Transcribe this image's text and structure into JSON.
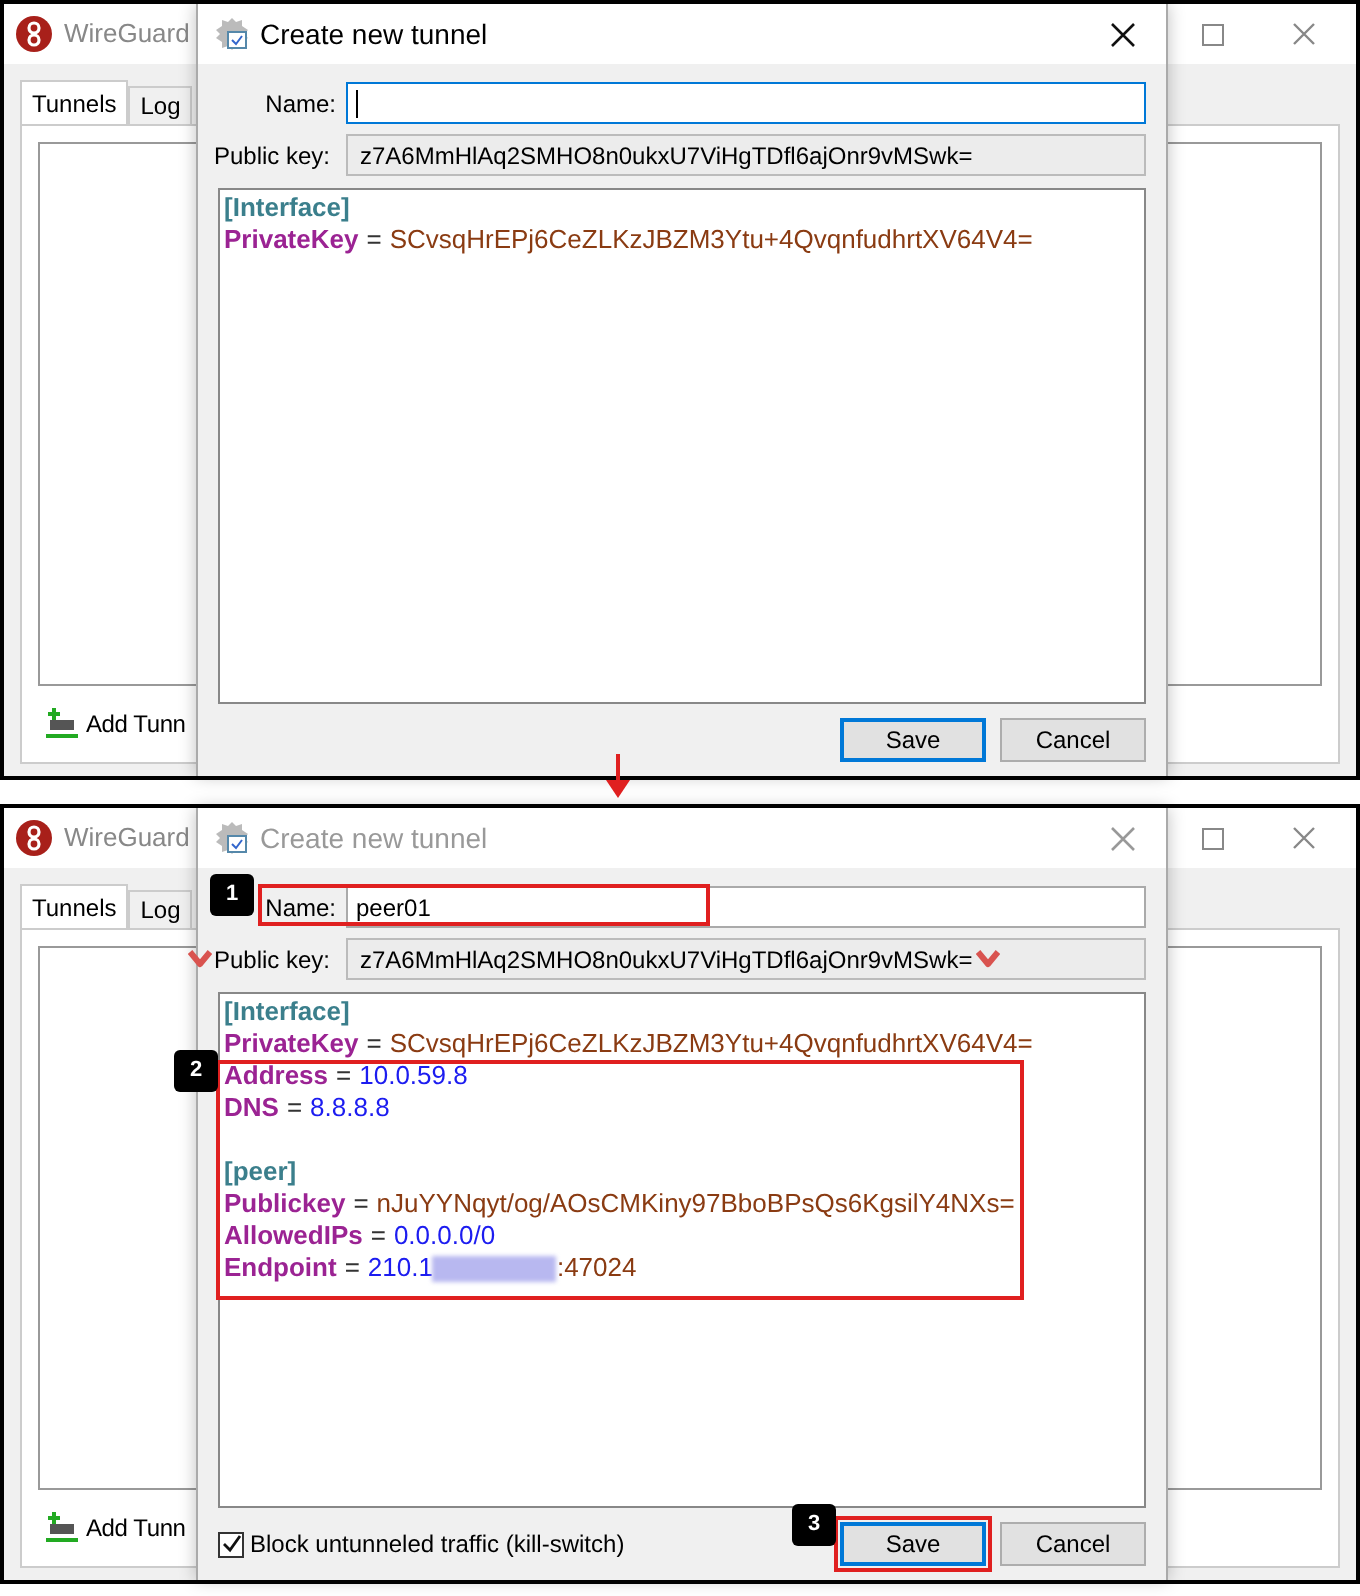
{
  "panels": [
    {
      "main_window": {
        "title": "WireGuard",
        "tabs": [
          {
            "label": "Tunnels",
            "selected": true
          },
          {
            "label": "Log",
            "selected": false
          }
        ],
        "add_button": "Add Tunn"
      },
      "dialog": {
        "title": "Create new tunnel",
        "active": true,
        "name_label": "Name:",
        "name_focused": true,
        "public_key_label": "Public key:",
        "public_key": "z7A6MmHlAq2SMHO8n0ukxU7ViHgTDfl6ajOnr9vMSwk=",
        "config": [
          {
            "kind": "section",
            "text": "[Interface]"
          },
          {
            "kind": "pair",
            "key": "PrivateKey",
            "separator": "=",
            "parts": [
              {
                "kind": "text",
                "color": "#8a3b12",
                "text": "SCvsqHrEPj6CeZLKzJBZM3Ytu+4QvqnfudhrtXV64V4="
              }
            ]
          }
        ],
        "buttons": [
          {
            "label": "Save",
            "default": true
          },
          {
            "label": "Cancel",
            "default": false
          }
        ]
      }
    },
    {
      "main_window": {
        "title": "WireGuard",
        "tabs": [
          {
            "label": "Tunnels",
            "selected": true
          },
          {
            "label": "Log",
            "selected": false
          }
        ],
        "add_button": "Add Tunn"
      },
      "dialog": {
        "title": "Create new tunnel",
        "active": false,
        "name_label": "Name:",
        "name_value": "peer01",
        "name_focused": false,
        "name_step": "1",
        "public_key_label": "Public key:",
        "public_key": "z7A6MmHlAq2SMHO8n0ukxU7ViHgTDfl6ajOnr9vMSwk=",
        "public_key_marked": true,
        "config_step": "2",
        "config": [
          {
            "kind": "section",
            "text": "[Interface]"
          },
          {
            "kind": "pair",
            "key": "PrivateKey",
            "separator": "=",
            "parts": [
              {
                "kind": "text",
                "color": "#8a3b12",
                "text": "SCvsqHrEPj6CeZLKzJBZM3Ytu+4QvqnfudhrtXV64V4="
              }
            ]
          },
          {
            "kind": "pair",
            "key": "Address",
            "separator": "=",
            "parts": [
              {
                "kind": "text",
                "color": "#1c1cf0",
                "text": "10.0.59.8"
              }
            ]
          },
          {
            "kind": "pair",
            "key": "DNS",
            "separator": "=",
            "parts": [
              {
                "kind": "text",
                "color": "#1c1cf0",
                "text": "8.8.8.8"
              }
            ]
          },
          {
            "kind": "blank"
          },
          {
            "kind": "section",
            "text": "[peer]"
          },
          {
            "kind": "pair",
            "key": "Publickey",
            "separator": "=",
            "parts": [
              {
                "kind": "text",
                "color": "#8a3b12",
                "text": "nJuYYNqyt/og/AOsCMKiny97BboBPsQs6KgsilY4NXs="
              }
            ]
          },
          {
            "kind": "pair",
            "key": "AllowedIPs",
            "separator": "=",
            "parts": [
              {
                "kind": "text",
                "color": "#1c1cf0",
                "text": "0.0.0.0/0"
              }
            ]
          },
          {
            "kind": "pair",
            "key": "Endpoint",
            "separator": "=",
            "parts": [
              {
                "kind": "text",
                "color": "#1c1cf0",
                "text": "210.1"
              },
              {
                "kind": "redacted"
              },
              {
                "kind": "text",
                "color": "#8a3b12",
                "text": ":47024"
              }
            ]
          }
        ],
        "kill_switch": {
          "label": "Block untunneled traffic (kill-switch)",
          "checked": true
        },
        "buttons": [
          {
            "label": "Save",
            "default": true,
            "step": "3"
          },
          {
            "label": "Cancel",
            "default": false
          }
        ]
      }
    }
  ]
}
